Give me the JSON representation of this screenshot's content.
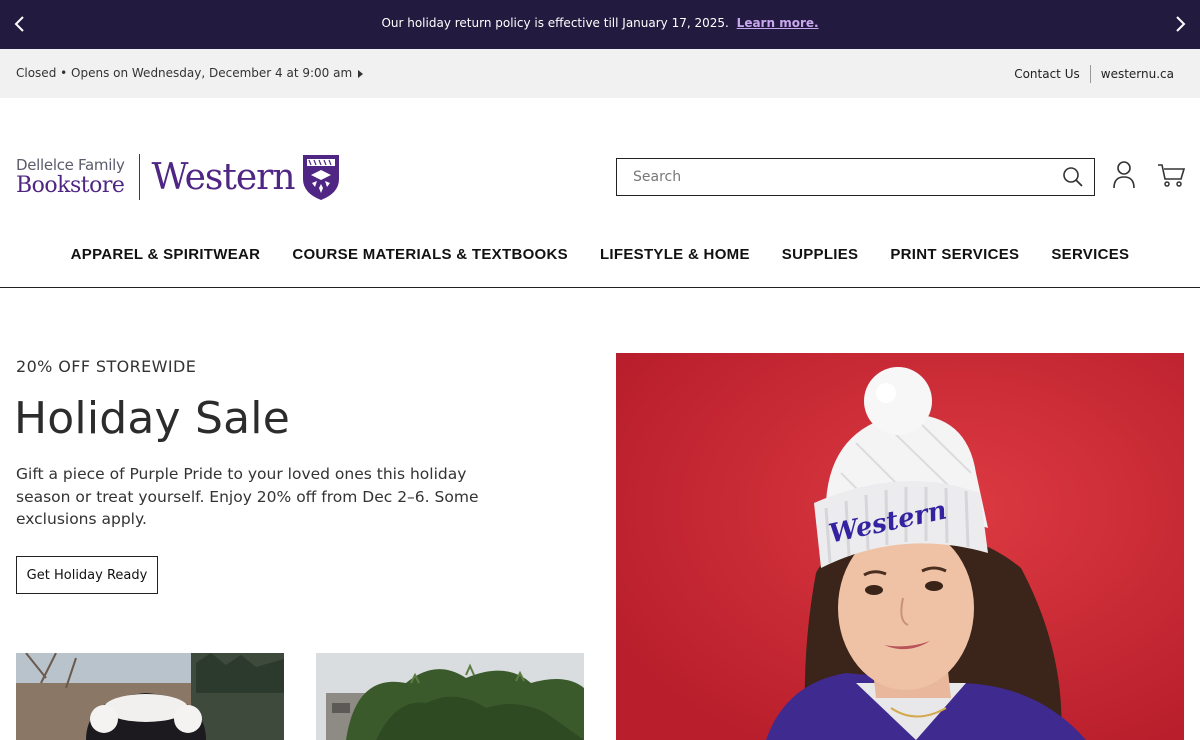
{
  "announcement": {
    "message": "Our holiday return policy is effective till January 17, 2025.",
    "link_label": "Learn more."
  },
  "utility": {
    "hours": "Closed • Opens on Wednesday, December 4 at 9:00 am",
    "contact": "Contact Us",
    "site": "westernu.ca"
  },
  "logo": {
    "line1": "Dellelce Family",
    "line2": "Bookstore",
    "western": "Western"
  },
  "search": {
    "placeholder": "Search"
  },
  "nav": [
    {
      "label": "APPAREL & SPIRITWEAR"
    },
    {
      "label": "COURSE MATERIALS & TEXTBOOKS"
    },
    {
      "label": "LIFESTYLE & HOME"
    },
    {
      "label": "SUPPLIES"
    },
    {
      "label": "PRINT SERVICES"
    },
    {
      "label": "SERVICES"
    }
  ],
  "hero": {
    "eyebrow": "20% OFF STOREWIDE",
    "title": "Holiday Sale",
    "body": "Gift a piece of Purple Pride to your loved ones this holiday season or treat yourself. Enjoy 20% off from Dec 2–6. Some exclusions apply.",
    "cta": "Get Holiday Ready",
    "toque_text": "Western"
  },
  "colors": {
    "brand_purple": "#4f2683",
    "announcement_bg": "#231a3f",
    "utility_bg": "#f1f1f1",
    "hero_photo_bg": "#d3303a"
  },
  "icons": [
    "chevron-left-icon",
    "chevron-right-icon",
    "caret-right-icon",
    "search-icon",
    "account-icon",
    "cart-icon",
    "crest-icon"
  ]
}
